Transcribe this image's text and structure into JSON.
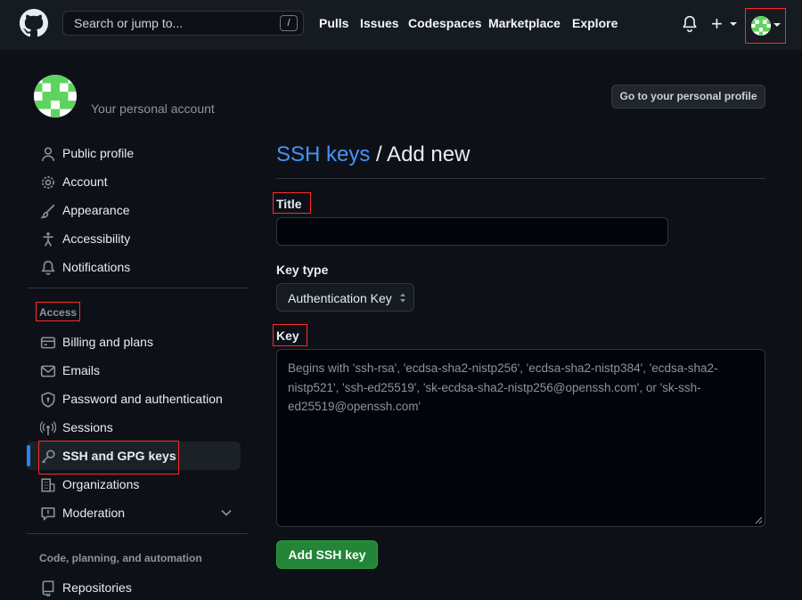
{
  "header": {
    "search_placeholder": "Search or jump to...",
    "search_shortcut": "/",
    "nav": [
      "Pulls",
      "Issues",
      "Codespaces",
      "Marketplace",
      "Explore"
    ],
    "plus": "+"
  },
  "account": {
    "label": "Your personal account",
    "profile_button": "Go to your personal profile"
  },
  "sidebar": {
    "items_top": [
      {
        "label": "Public profile",
        "icon": "person-icon"
      },
      {
        "label": "Account",
        "icon": "gear-icon"
      },
      {
        "label": "Appearance",
        "icon": "paintbrush-icon"
      },
      {
        "label": "Accessibility",
        "icon": "accessibility-icon"
      },
      {
        "label": "Notifications",
        "icon": "bell-icon"
      }
    ],
    "access_label": "Access",
    "items_access": [
      {
        "label": "Billing and plans",
        "icon": "credit-card-icon"
      },
      {
        "label": "Emails",
        "icon": "mail-icon"
      },
      {
        "label": "Password and authentication",
        "icon": "shield-lock-icon"
      },
      {
        "label": "Sessions",
        "icon": "broadcast-icon"
      },
      {
        "label": "SSH and GPG keys",
        "icon": "key-icon"
      },
      {
        "label": "Organizations",
        "icon": "organization-icon"
      },
      {
        "label": "Moderation",
        "icon": "report-icon"
      }
    ],
    "code_label": "Code, planning, and automation",
    "items_code": [
      {
        "label": "Repositories",
        "icon": "repo-icon"
      }
    ]
  },
  "main": {
    "heading_link": "SSH keys",
    "heading_rest": " / Add new",
    "title_label": "Title",
    "key_type_label": "Key type",
    "key_type_value": "Authentication Key",
    "key_label": "Key",
    "key_placeholder": "Begins with 'ssh-rsa', 'ecdsa-sha2-nistp256', 'ecdsa-sha2-nistp384', 'ecdsa-sha2-nistp521', 'ssh-ed25519', 'sk-ecdsa-sha2-nistp256@openssh.com', or 'sk-ssh-ed25519@openssh.com'",
    "submit_button": "Add SSH key"
  },
  "colors": {
    "background": "#0d1117",
    "header": "#161b22",
    "link": "#4493f8",
    "primary_button": "#238636",
    "highlight_box": "#ff2a2a",
    "avatar_green": "#5fd35f"
  }
}
